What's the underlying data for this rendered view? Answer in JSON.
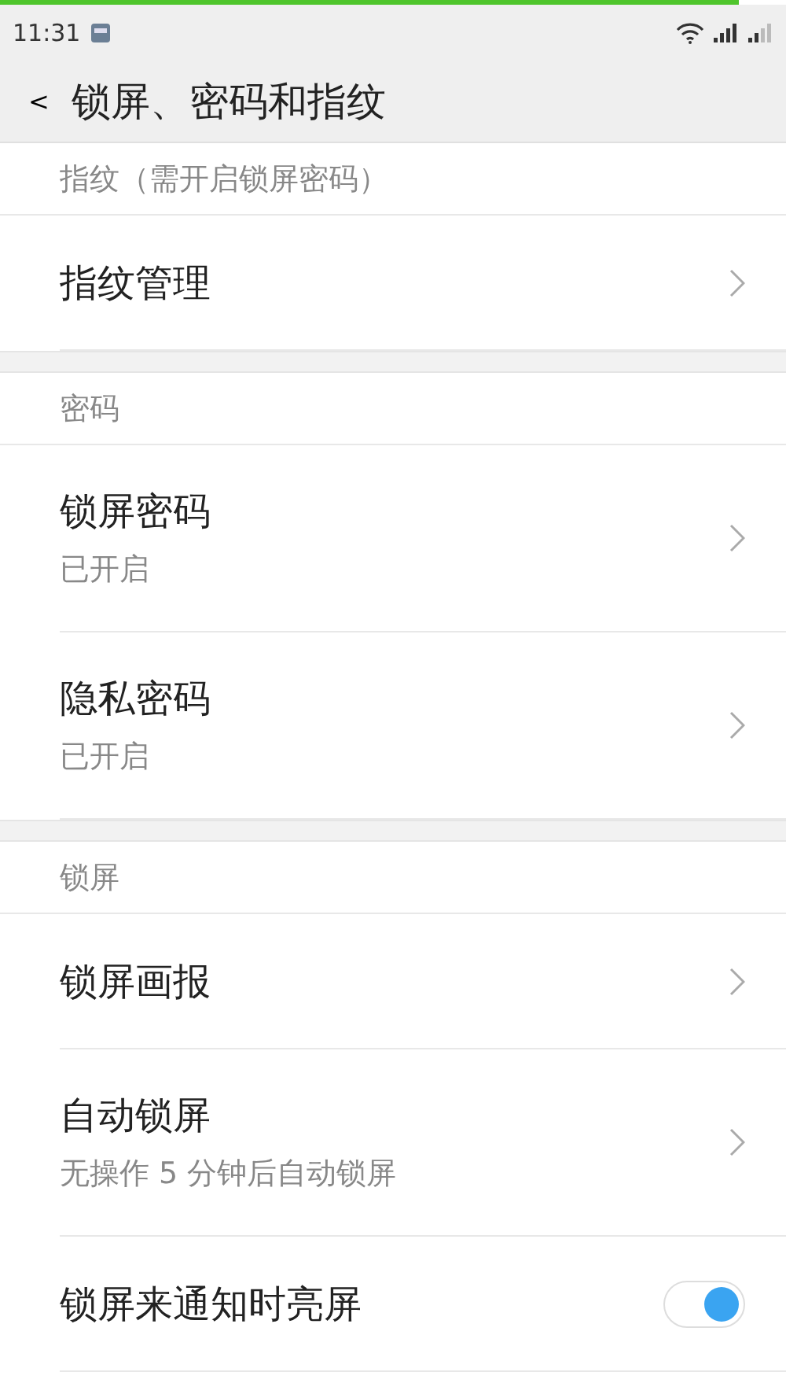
{
  "status_bar": {
    "time": "11:31"
  },
  "header": {
    "back": "<",
    "title": "锁屏、密码和指纹"
  },
  "sections": [
    {
      "title": "指纹（需开启锁屏密码）",
      "items": [
        {
          "kind": "link",
          "label": "指纹管理"
        }
      ]
    },
    {
      "title": "密码",
      "items": [
        {
          "kind": "link",
          "label": "锁屏密码",
          "subtitle": "已开启"
        },
        {
          "kind": "link",
          "label": "隐私密码",
          "subtitle": "已开启"
        }
      ]
    },
    {
      "title": "锁屏",
      "items": [
        {
          "kind": "link",
          "label": "锁屏画报"
        },
        {
          "kind": "link",
          "label": "自动锁屏",
          "subtitle": "无操作 5 分钟后自动锁屏"
        },
        {
          "kind": "toggle",
          "label": "锁屏来通知时亮屏",
          "on": true
        }
      ]
    }
  ]
}
